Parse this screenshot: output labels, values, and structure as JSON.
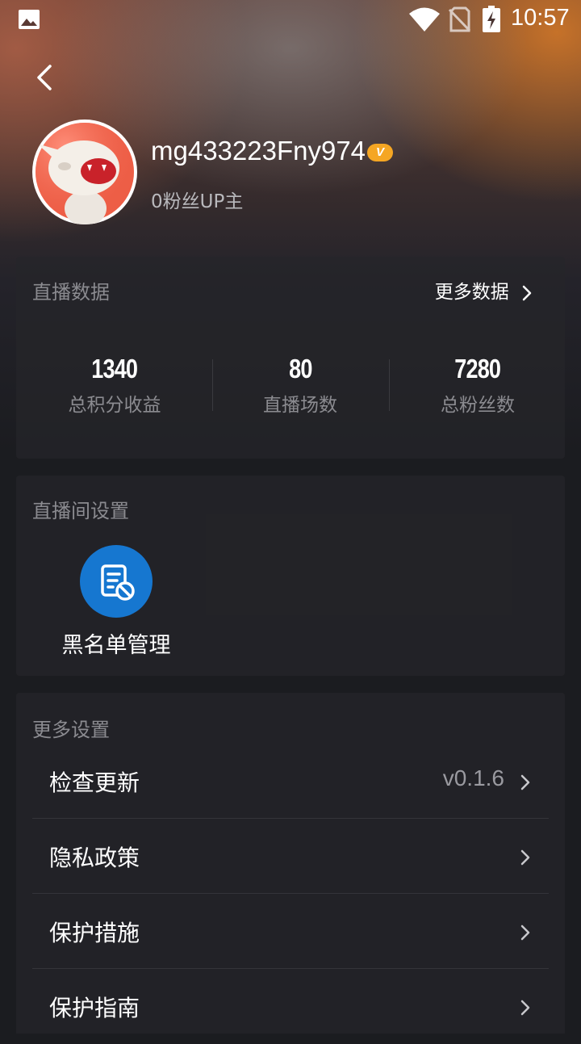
{
  "status_bar": {
    "time": "10:57",
    "icons": [
      "photo-icon",
      "wifi-icon",
      "no-sim-icon",
      "battery-charging-icon"
    ]
  },
  "header": {
    "back_icon": "back-arrow-icon",
    "username": "mg433223Fny974",
    "badge": "V",
    "subtitle": "0粉丝UP主"
  },
  "live_data": {
    "title": "直播数据",
    "more_label": "更多数据",
    "stats": [
      {
        "value": "1340",
        "label": "总积分收益"
      },
      {
        "value": "80",
        "label": "直播场数"
      },
      {
        "value": "7280",
        "label": "总粉丝数"
      }
    ]
  },
  "room_settings": {
    "title": "直播间设置",
    "blacklist_label": "黑名单管理",
    "blacklist_icon": "blacklist-document-icon",
    "accent": "#1677d0"
  },
  "more_settings": {
    "title": "更多设置",
    "items": [
      {
        "label": "检查更新",
        "value": "v0.1.6"
      },
      {
        "label": "隐私政策",
        "value": ""
      },
      {
        "label": "保护措施",
        "value": ""
      },
      {
        "label": "保护指南",
        "value": ""
      }
    ]
  },
  "colors": {
    "background": "#1b1c20",
    "card": "#26262a",
    "badge": "#f5a623",
    "muted_text": "#8b8b90"
  }
}
